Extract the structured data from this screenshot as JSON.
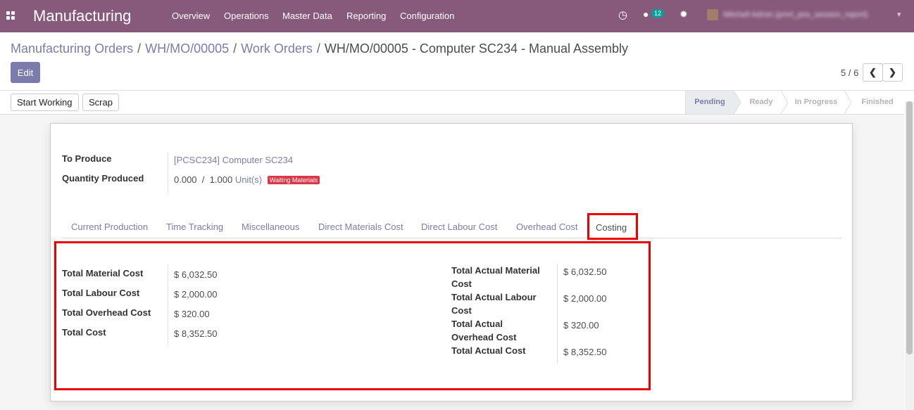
{
  "navbar": {
    "app_title": "Manufacturing",
    "menu": [
      "Overview",
      "Operations",
      "Master Data",
      "Reporting",
      "Configuration"
    ],
    "clock_icon": "◷",
    "chat_icon": "●",
    "chat_badge": "12",
    "debug_icon": "✹",
    "user_name": "Mitchell Admin (pmrt_pos_session_report)",
    "user_caret": "▾",
    "colors": {
      "bar": "#875a7b",
      "badge": "#00a09d"
    }
  },
  "breadcrumb": {
    "items": [
      "Manufacturing Orders",
      "WH/MO/00005",
      "Work Orders"
    ],
    "separator": "/",
    "current": "WH/MO/00005 - Computer SC234 - Manual Assembly"
  },
  "actions": {
    "edit": "Edit",
    "start_working": "Start Working",
    "scrap": "Scrap"
  },
  "pager": {
    "value": "5 / 6",
    "prev": "❮",
    "next": "❯"
  },
  "status_stages": [
    "Pending",
    "Ready",
    "In Progress",
    "Finished"
  ],
  "status_current": "Pending",
  "form": {
    "to_produce_label": "To Produce",
    "to_produce_value": "[PCSC234] Computer SC234",
    "qty_label": "Quantity Produced",
    "qty_done": "0.000",
    "qty_sep": "/",
    "qty_total": "1.000",
    "qty_uom": "Unit(s)",
    "qty_badge": "Waiting Materials"
  },
  "tabs": [
    "Current Production",
    "Time Tracking",
    "Miscellaneous",
    "Direct Materials Cost",
    "Direct Labour Cost",
    "Overhead Cost",
    "Costing"
  ],
  "active_tab": "Costing",
  "costing": {
    "left": [
      {
        "label": "Total Material Cost",
        "value": "$ 6,032.50"
      },
      {
        "label": "Total Labour Cost",
        "value": "$ 2,000.00"
      },
      {
        "label": "Total Overhead Cost",
        "value": "$ 320.00"
      },
      {
        "label": "Total Cost",
        "value": "$ 8,352.50"
      }
    ],
    "right": [
      {
        "label_line1": "Total Actual Material",
        "label_line2": "Cost",
        "value": "$ 6,032.50"
      },
      {
        "label_line1": "Total Actual Labour",
        "label_line2": "Cost",
        "value": "$ 2,000.00"
      },
      {
        "label_line1": "Total Actual",
        "label_line2": "Overhead Cost",
        "value": "$ 320.00"
      },
      {
        "label_line1": "Total Actual Cost",
        "label_line2": "",
        "value": "$ 8,352.50"
      }
    ]
  },
  "colors": {
    "accent": "#7c7bad",
    "highlight": "#ee0000",
    "badge_danger": "#dc3545"
  }
}
